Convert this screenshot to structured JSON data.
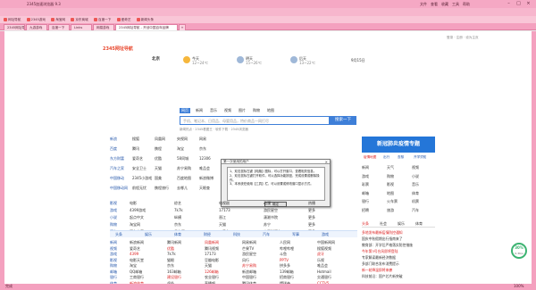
{
  "window": {
    "title": "2345加速浏览器 9.3",
    "menu_right": [
      "文件",
      "查看",
      "收藏",
      "工具",
      "帮助"
    ]
  },
  "toolbar": {
    "address": "https://www.2345.com/?kduba",
    "search_placeholder": "百度"
  },
  "bookmarks": [
    "网址导航",
    "2345游戏",
    "淘宝网",
    "京东商城",
    "百度一下",
    "爱奇艺",
    "新闻头条"
  ],
  "tabs": [
    {
      "label": "2345网址导航",
      "active": false
    },
    {
      "label": "九游游戏",
      "active": false
    },
    {
      "label": "百度一下",
      "active": false
    },
    {
      "label": "Links",
      "active": false
    },
    {
      "label": "网易游戏",
      "active": false
    },
    {
      "label": "2345网址导航 - 开创中国百年品牌",
      "active": true
    }
  ],
  "page": {
    "logo": "2345网址导航",
    "city": "北京",
    "weather": [
      {
        "day": "今天",
        "text": "多云",
        "temp": "12~24℃"
      },
      {
        "day": "明天",
        "text": "晴转阴",
        "temp": "15~26℃"
      },
      {
        "day": "后天",
        "text": "阵雨",
        "temp": "13~22℃"
      }
    ],
    "date": "9月15日",
    "top_links": [
      "登录",
      "注册",
      "设为主页",
      "天气预报"
    ],
    "search_tabs": [
      "网页",
      "新闻",
      "音乐",
      "视频",
      "图片",
      "购物",
      "地图"
    ],
    "search_placeholder": "手机、笔记本、日用品、母婴用品，特价商品一网打尽",
    "search_button": "搜索一下",
    "hot_words": [
      "新闻热点",
      "2345看图王",
      "软件下载",
      "2345浏览器"
    ],
    "banner": "新冠肺炎疫情专题",
    "banner_sub": [
      "疫情地图",
      "出行",
      "查核",
      "开学须知"
    ],
    "famous_sites": [
      [
        "新浪",
        "搜狐",
        "凤凰网",
        "央视网",
        "网易"
      ],
      [
        "百度",
        "腾讯",
        "携程",
        "淘宝",
        "京东"
      ],
      [
        "东方财富",
        "爱奇艺",
        "优酷",
        "58同城",
        "12306"
      ],
      [
        "汽车之家",
        "安全卫士",
        "天猫",
        "苏宁易购",
        "唯品会"
      ],
      [
        "中国移动",
        "2345小游戏",
        "国美",
        "百度地图",
        "新浪微博"
      ],
      [
        "中国移动网",
        "前程无忧",
        "携程旅行",
        "去哪儿",
        "天眼查"
      ]
    ],
    "category_rows": [
      {
        "cat": "影视",
        "items": [
          "电影",
          "综艺",
          "电视剧",
          "动漫",
          "热播"
        ]
      },
      {
        "cat": "游戏",
        "items": [
          "4399游戏",
          "7k7k",
          "17173",
          "游民星空",
          "更多"
        ]
      },
      {
        "cat": "小说",
        "items": [
          "起点中文",
          "纵横",
          "晋江",
          "潇湘书院",
          "更多"
        ]
      },
      {
        "cat": "购物",
        "items": [
          "淘宝网",
          "京东",
          "天猫",
          "苏宁",
          "更多"
        ]
      },
      {
        "cat": "汽车",
        "items": [
          "汽车之家",
          "易车网",
          "二手车",
          "太平洋汽车",
          "更多"
        ]
      }
    ],
    "grid_rows": [
      {
        "cat": "新闻",
        "items": [
          "新浪新闻",
          "腾讯新闻",
          "凤凰新闻",
          "网易新闻",
          "人民网",
          "中国新闻网"
        ]
      },
      {
        "cat": "视频",
        "items": [
          "爱奇艺",
          "优酷",
          "腾讯视频",
          "芒果TV",
          "哔哩哔哩",
          "搜狐视频"
        ]
      },
      {
        "cat": "游戏",
        "items": [
          "4399",
          "7k7k",
          "17173",
          "游民星空",
          "斗鱼",
          "虎牙"
        ]
      },
      {
        "cat": "影视",
        "items": [
          "电影天堂",
          "猫眼",
          "豆瓣电影",
          "风行",
          "PPTV",
          "乐视"
        ]
      },
      {
        "cat": "购物",
        "items": [
          "淘宝",
          "京东",
          "天猫",
          "苏宁易购",
          "拼多多",
          "唯品会"
        ]
      },
      {
        "cat": "邮箱",
        "items": [
          "QQ邮箱",
          "163邮箱",
          "126邮箱",
          "新浪邮箱",
          "139邮箱",
          "Hotmail"
        ]
      },
      {
        "cat": "银行",
        "items": [
          "工商银行",
          "建设银行",
          "农业银行",
          "中国银行",
          "招商银行",
          "交通银行"
        ]
      },
      {
        "cat": "体育",
        "items": [
          "新浪体育",
          "虎扑",
          "直播吧",
          "腾讯体育",
          "懂球帝",
          "CCTV5"
        ]
      },
      {
        "cat": "军事",
        "items": [
          "环球网",
          "铁血网",
          "中华网",
          "西陆网",
          "米尔网",
          "战略网"
        ]
      }
    ],
    "strip_tabs": [
      "头条",
      "娱乐",
      "体育",
      "财经",
      "科技",
      "汽车",
      "军事",
      "游戏"
    ],
    "side_panel": {
      "tabs": [
        "头条",
        "社会",
        "娱乐",
        "体育"
      ],
      "grid": [
        [
          "新闻",
          "天气",
          "视频"
        ],
        [
          "游戏",
          "购物",
          "小说"
        ],
        [
          "彩票",
          "影视",
          "音乐"
        ],
        [
          "邮箱",
          "地图",
          "体育"
        ],
        [
          "银行",
          "火车票",
          "机票"
        ],
        [
          "招聘",
          "旅游",
          "汽车"
        ]
      ],
      "news": [
        "多地发布最新疫情防控通知",
        "国庆中秋假期出行指南来了",
        "教育部：开学后严格落实防控措施",
        "今年第3号台风即将登陆",
        "专家解读最新经济数据",
        "多部门联合发布消费提示",
        "新一轮降温即将来袭",
        "科技前沿：国产芯片新突破"
      ]
    },
    "dialog": {
      "title": "第一次使用的用户",
      "lines": [
        "1、双击鼠标左键【电脑】图标，可以打开窗口，查看相关信息。",
        "2、双击鼠标左键打开软件，可以选择功能按钮，完成设置或删除操作。",
        "3、本系统在使用【工具】栏，可以设置或修改窗口显示方式。"
      ],
      "ok": "确定"
    },
    "progress": "30%",
    "progress_sub": "0.3K/s"
  },
  "status": {
    "left": "完成",
    "right": "100%"
  }
}
